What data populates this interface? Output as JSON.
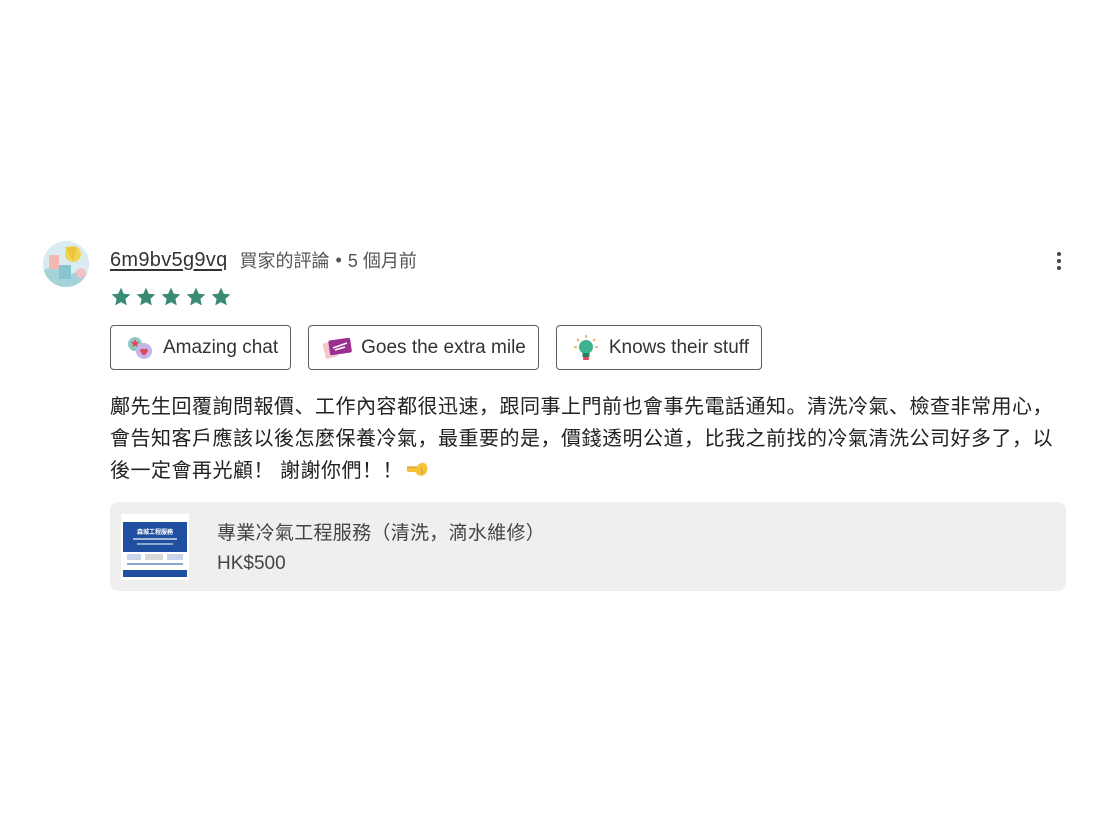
{
  "review": {
    "username": "6m9bv5g9vq",
    "review_type": "買家的評論",
    "separator": "•",
    "time_ago": "5 個月前",
    "rating": 5,
    "star_color": "#3a8b76",
    "badges": [
      {
        "label": "Amazing chat",
        "icon": "chat-heart-icon"
      },
      {
        "label": "Goes the extra mile",
        "icon": "ticket-icon"
      },
      {
        "label": "Knows their stuff",
        "icon": "lightbulb-icon"
      }
    ],
    "text": "鄺先生回覆詢問報價、工作內容都很迅速，跟同事上門前也會事先電話通知。清洗冷氣、檢查非常用心，會告知客戶應該以後怎麼保養冷氣，最重要的是，價錢透明公道，比我之前找的冷氣清洗公司好多了，以後一定會再光顧！ 謝謝你們！！",
    "text_emoji": "pointing-hand-icon"
  },
  "service": {
    "title": "專業冷氣工程服務（清洗，滴水維修）",
    "price": "HK$500",
    "thumb_title": "森城工程服務"
  }
}
